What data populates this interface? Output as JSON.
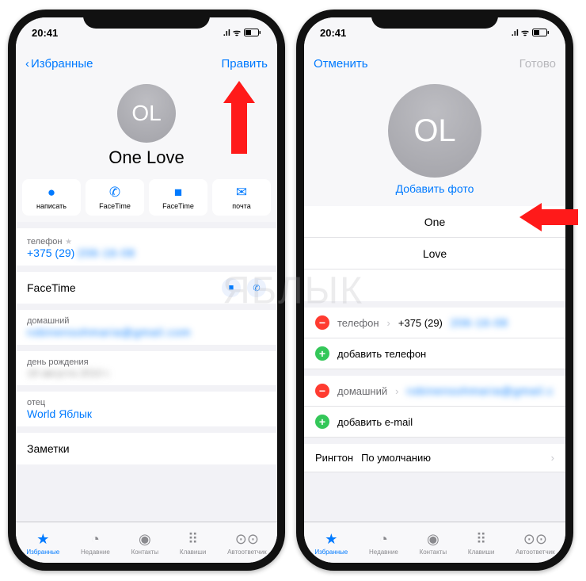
{
  "watermark": "ЯБЛЫК",
  "status": {
    "time": "20:41",
    "signal": "▪▪▪▪",
    "wifi": "◎",
    "battery": "▢"
  },
  "left": {
    "nav": {
      "back": "Избранные",
      "edit": "Править"
    },
    "avatar_initials": "OL",
    "contact_name": "One Love",
    "apple_mark": "",
    "actions": [
      {
        "icon": "💬",
        "label": "написать"
      },
      {
        "icon": "📞",
        "label": "FaceTime"
      },
      {
        "icon": "■",
        "label": "FaceTime"
      },
      {
        "icon": "✉",
        "label": "почта"
      }
    ],
    "phone": {
      "label": "телефон",
      "value": "+375 (29)"
    },
    "facetime": {
      "label": "FaceTime"
    },
    "email": {
      "label": "домашний"
    },
    "birthday": {
      "label": "день рождения"
    },
    "father": {
      "label": "отец",
      "value": "World Яблык"
    },
    "notes": {
      "label": "Заметки"
    }
  },
  "right": {
    "nav": {
      "cancel": "Отменить",
      "done": "Готово"
    },
    "avatar_initials": "OL",
    "add_photo": "Добавить фото",
    "first_name": "One",
    "last_name": "Love",
    "apple_mark": "",
    "phone_field": {
      "label": "телефон",
      "value": "+375 (29)"
    },
    "add_phone": "добавить телефон",
    "email_field": {
      "label": "домашний"
    },
    "add_email": "добавить e-mail",
    "ringtone": {
      "label": "Рингтон",
      "value": "По умолчанию"
    }
  },
  "tabs": [
    {
      "icon": "★",
      "label": "Избранные"
    },
    {
      "icon": "◔",
      "label": "Недавние"
    },
    {
      "icon": "◉",
      "label": "Контакты"
    },
    {
      "icon": "⠿",
      "label": "Клавиши"
    },
    {
      "icon": "⊙⊙",
      "label": "Автоответчик"
    }
  ]
}
